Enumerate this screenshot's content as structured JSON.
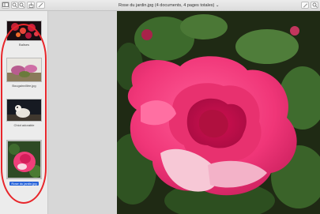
{
  "window": {
    "title": "Rose du jardin.jpg (4 documents, 4 pages totales)",
    "chevron": "⌄"
  },
  "toolbar": {
    "sidebar_icon": "sidebar-toggle-icon",
    "zoom_out_icon": "zoom-out-icon",
    "zoom_in_icon": "zoom-in-icon",
    "share_icon": "share-icon",
    "markup_icon": "pen-icon",
    "search_icon": "search-icon"
  },
  "sidebar": {
    "items": [
      {
        "label": "Balises"
      },
      {
        "label": "Bougainvillée.jpg"
      },
      {
        "label": "Chiot adorable"
      },
      {
        "label": "Rose du jardin.jpg",
        "selected": true
      }
    ]
  },
  "colors": {
    "selection": "#2563d9",
    "annotation_ring": "#e8262b"
  }
}
